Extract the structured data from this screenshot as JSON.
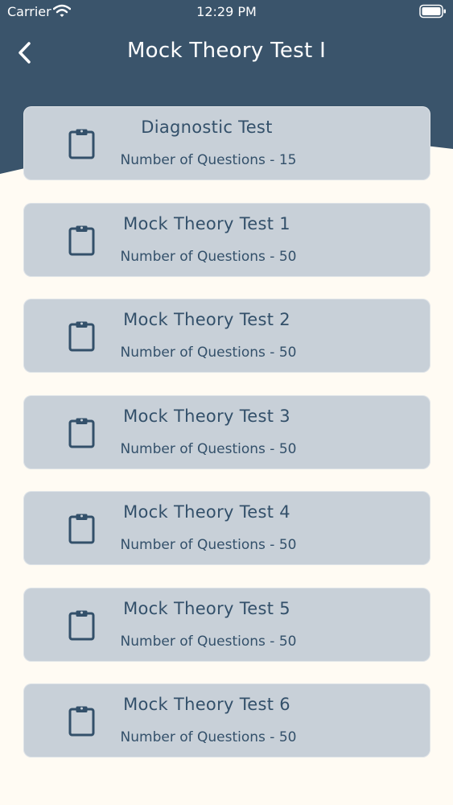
{
  "status_bar": {
    "carrier": "Carrier",
    "time": "12:29 PM",
    "wifi_icon": "wifi-icon",
    "battery_icon": "battery-icon"
  },
  "header": {
    "title": "Mock Theory Test I",
    "back_icon": "chevron-left-icon",
    "background_color": "#3a546b"
  },
  "tests": [
    {
      "title": "Diagnostic Test",
      "subtitle": "Number of Questions - 15",
      "icon": "clipboard-icon"
    },
    {
      "title": "Mock Theory Test 1",
      "subtitle": "Number of Questions - 50",
      "icon": "clipboard-icon"
    },
    {
      "title": "Mock Theory Test 2",
      "subtitle": "Number of Questions - 50",
      "icon": "clipboard-icon"
    },
    {
      "title": "Mock Theory Test 3",
      "subtitle": "Number of Questions - 50",
      "icon": "clipboard-icon"
    },
    {
      "title": "Mock Theory Test 4",
      "subtitle": "Number of Questions - 50",
      "icon": "clipboard-icon"
    },
    {
      "title": "Mock Theory Test 5",
      "subtitle": "Number of Questions - 50",
      "icon": "clipboard-icon"
    },
    {
      "title": "Mock Theory Test 6",
      "subtitle": "Number of Questions - 50",
      "icon": "clipboard-icon"
    }
  ],
  "colors": {
    "background": "#fffbf3",
    "card": "#c8d0d8",
    "card_text": "#33506a",
    "header": "#3a546b"
  }
}
